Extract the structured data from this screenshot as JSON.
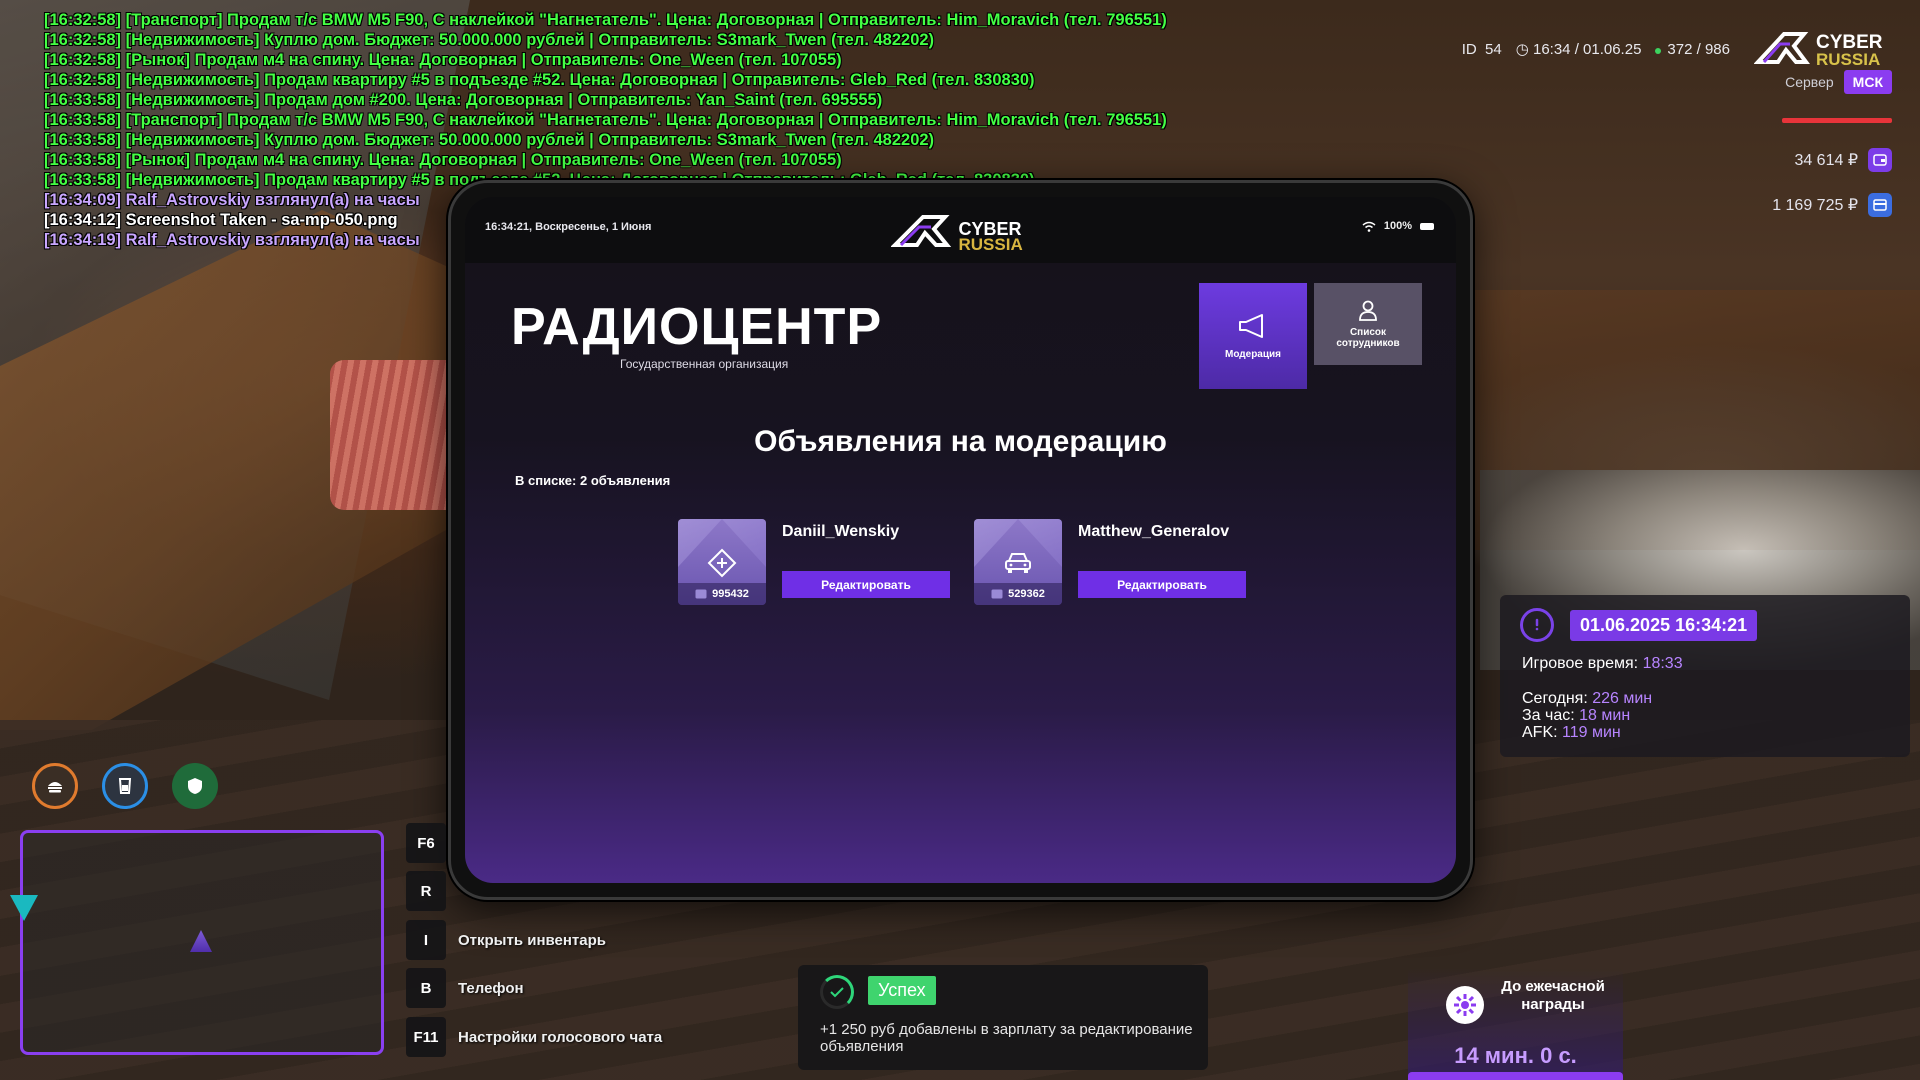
{
  "chat": [
    {
      "text": "[16:32:58] [Транспорт] Продам т/с BMW M5 F90, С наклейкой \"Нагнетатель\". Цена: Договорная | Отправитель: Him_Moravich (тел. 796551)",
      "color": "g"
    },
    {
      "text": "[16:32:58] [Недвижимость] Куплю дом. Бюджет: 50.000.000 рублей | Отправитель: S3mark_Twen (тел. 482202)",
      "color": "g"
    },
    {
      "text": "[16:32:58] [Рынок] Продам м4 на спину. Цена: Договорная | Отправитель: One_Ween (тел. 107055)",
      "color": "g"
    },
    {
      "text": "[16:32:58] [Недвижимость] Продам квартиру #5 в подъезде #52. Цена: Договорная | Отправитель: Gleb_Red (тел. 830830)",
      "color": "g"
    },
    {
      "text": "[16:33:58] [Недвижимость] Продам дом #200. Цена: Договорная | Отправитель: Yan_Saint (тел. 695555)",
      "color": "g"
    },
    {
      "text": "[16:33:58] [Транспорт] Продам т/с BMW M5 F90, С наклейкой \"Нагнетатель\". Цена: Договорная | Отправитель: Him_Moravich (тел. 796551)",
      "color": "g"
    },
    {
      "text": "[16:33:58] [Недвижимость] Куплю дом. Бюджет: 50.000.000 рублей | Отправитель: S3mark_Twen (тел. 482202)",
      "color": "g"
    },
    {
      "text": "[16:33:58] [Рынок] Продам м4 на спину. Цена: Договорная | Отправитель: One_Ween (тел. 107055)",
      "color": "g"
    },
    {
      "text": "[16:33:58] [Недвижимость] Продам квартиру #5 в подъезде #52. Цена: Договорная | Отправитель: Gleb_Red (тел. 830830)",
      "color": "g"
    },
    {
      "text": "[16:34:09] Ralf_Astrovskiy взглянул(а) на часы",
      "color": "p"
    },
    {
      "text": "[16:34:12] Screenshot Taken - sa-mp-050.png",
      "color": "w"
    },
    {
      "text": "[16:34:19] Ralf_Astrovskiy взглянул(а) на часы",
      "color": "p"
    }
  ],
  "hud": {
    "id_label": "ID",
    "id_value": "54",
    "time": "16:34 / 01.06.25",
    "online": "372",
    "online_max": "986",
    "logo_line1": "CYBER",
    "logo_line2": "RUSSIA",
    "server_label": "Сервер",
    "server_tag": "МСК",
    "cash": "34 614 ₽",
    "bank": "1 169 725 ₽"
  },
  "tablet": {
    "status_time": "16:34:21, Воскресенье, 1 Июня",
    "battery": "100%",
    "logo_line1": "CYBER",
    "logo_line2": "RUSSIA",
    "org_title": "РАДИОЦЕНТР",
    "org_subtitle": "Государственная организация",
    "nav": {
      "moderation": "Модерация",
      "staff": "Список сотрудников"
    },
    "heading": "Объявления на модерацию",
    "count": "В списке: 2 объявления",
    "ads": [
      {
        "name": "Daniil_Wenskiy",
        "id": "995432",
        "icon": "diamond-plus-icon",
        "button": "Редактировать"
      },
      {
        "name": "Matthew_Generalov",
        "id": "529362",
        "icon": "car-icon",
        "button": "Редактировать"
      }
    ]
  },
  "info": {
    "datetime": "01.06.2025 16:34:21",
    "game_time_label": "Игровое время:",
    "game_time": "18:33",
    "today_label": "Сегодня:",
    "today": "226 мин",
    "hour_label": "За час:",
    "hour": "18 мин",
    "afk_label": "AFK:",
    "afk": "119 мин"
  },
  "keys": [
    {
      "key": "F6",
      "label": ""
    },
    {
      "key": "R",
      "label": ""
    },
    {
      "key": "I",
      "label": "Открыть инвентарь"
    },
    {
      "key": "B",
      "label": "Телефон"
    },
    {
      "key": "F11",
      "label": "Настройки голосового чата"
    }
  ],
  "notify": {
    "badge": "Успех",
    "message": "+1 250 руб добавлены в зарплату за редактирование объявления"
  },
  "reward": {
    "title": "До ежечасной награды",
    "timer": "14 мин. 0 с."
  },
  "colors": {
    "accent": "#8b3cf0",
    "chat_green": "#44ff44",
    "success": "#3fd46e"
  }
}
